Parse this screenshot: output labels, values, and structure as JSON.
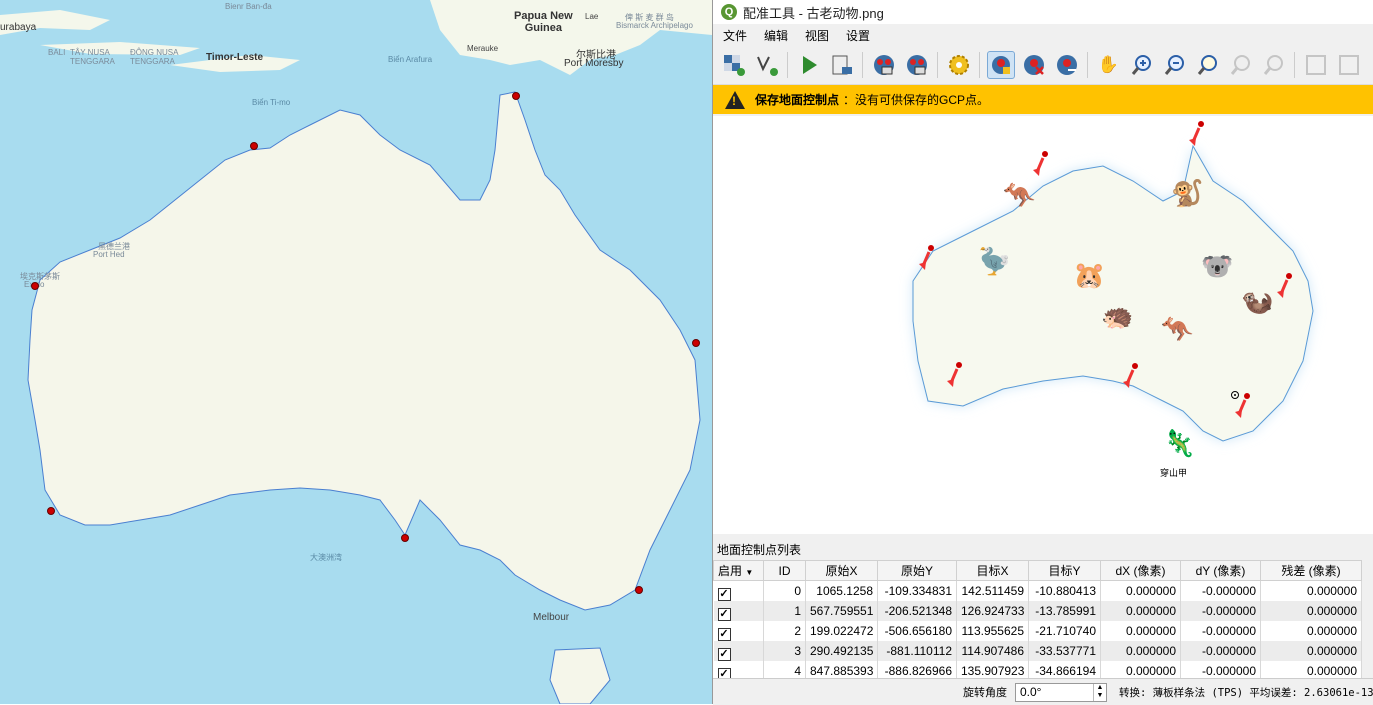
{
  "map": {
    "labels": {
      "surabaya": "urabaya",
      "bienr": "Bienr Ban-đa",
      "bali": "BALI",
      "tay_nusa": "TÂY NUSA\nTENGGARA",
      "dong_nusa": "ĐÔNG NUSA\nTENGGARA",
      "timor": "Timor-Leste",
      "arafura": "Biển Arafura",
      "papua": "Papua New\nGuinea",
      "bismarck_cn": "俾 斯 麦 群 岛",
      "bismarck": "Bismarck Archipelago",
      "merauke": "Merauke",
      "port_moresby_cn": "尔斯比港",
      "port_moresby": "Port Moresby",
      "lae": "Lae",
      "timor_sea": "Biển Ti-mo",
      "ocean": "大澳洲湾",
      "melbourne": "Melbour",
      "port_hedland_cn": "黑德兰港",
      "port_hedland": "Port Hed",
      "exmouth_cn": "埃克斯茅斯",
      "exmouth": "Exmo"
    }
  },
  "window": {
    "icon": "Q",
    "title": "配准工具 - 古老动物.png"
  },
  "menu": [
    "文件",
    "编辑",
    "视图",
    "设置"
  ],
  "toolbar": {
    "icons": [
      "open-raster-icon",
      "start-georef-icon",
      "run-icon",
      "generate-gdal-icon",
      "load-gcp-icon",
      "save-gcp-icon",
      "settings-gear-icon",
      "add-point-icon",
      "delete-point-icon",
      "move-point-icon",
      "pan-hand-icon",
      "zoom-in-icon",
      "zoom-out-icon",
      "zoom-layer-icon",
      "zoom-last-icon",
      "zoom-next-icon",
      "link-georef-icon",
      "link-qgis-icon"
    ]
  },
  "warning": {
    "bold": "保存地面控制点",
    "text": "：没有可供保存的GCP点。",
    "color": "#ffc200"
  },
  "canvas": {
    "pangolin_label": "穿山甲"
  },
  "gcp_panel": {
    "title": "地面控制点列表",
    "columns": [
      "启用",
      "ID",
      "原始X",
      "原始Y",
      "目标X",
      "目标Y",
      "dX (像素)",
      "dY (像素)",
      "残差 (像素)"
    ],
    "rows": [
      {
        "enabled": true,
        "id": "0",
        "src_x": "1065.1258",
        "src_y": "-109.334831",
        "dst_x": "142.511459",
        "dst_y": "-10.880413",
        "dx": "0.000000",
        "dy": "-0.000000",
        "res": "0.000000"
      },
      {
        "enabled": true,
        "id": "1",
        "src_x": "567.759551",
        "src_y": "-206.521348",
        "dst_x": "126.924733",
        "dst_y": "-13.785991",
        "dx": "0.000000",
        "dy": "-0.000000",
        "res": "0.000000"
      },
      {
        "enabled": true,
        "id": "2",
        "src_x": "199.022472",
        "src_y": "-506.656180",
        "dst_x": "113.955625",
        "dst_y": "-21.710740",
        "dx": "0.000000",
        "dy": "-0.000000",
        "res": "0.000000"
      },
      {
        "enabled": true,
        "id": "3",
        "src_x": "290.492135",
        "src_y": "-881.110112",
        "dst_x": "114.907486",
        "dst_y": "-33.537771",
        "dx": "0.000000",
        "dy": "-0.000000",
        "res": "0.000000"
      },
      {
        "enabled": true,
        "id": "4",
        "src_x": "847.885393",
        "src_y": "-886.826966",
        "dst_x": "135.907923",
        "dst_y": "-34.866194",
        "dx": "0.000000",
        "dy": "-0.000000",
        "res": "0.000000"
      }
    ]
  },
  "status": {
    "rotation_label": "旋转角度",
    "rotation_value": "0.0°",
    "transform": "转换: 薄板样条法 (TPS) 平均误差: 2.63061e-13"
  }
}
